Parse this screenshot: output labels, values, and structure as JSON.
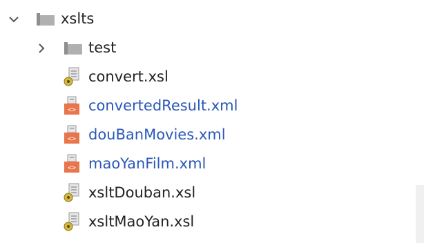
{
  "tree": {
    "root": {
      "label": "xslts",
      "expanded": true
    },
    "children": [
      {
        "label": "test",
        "kind": "folder",
        "expanded": false
      },
      {
        "label": "convert.xsl",
        "kind": "xsl"
      },
      {
        "label": "convertedResult.xml",
        "kind": "xml"
      },
      {
        "label": "douBanMovies.xml",
        "kind": "xml"
      },
      {
        "label": "maoYanFilm.xml",
        "kind": "xml"
      },
      {
        "label": "xsltDouban.xsl",
        "kind": "xsl"
      },
      {
        "label": "xsltMaoYan.xsl",
        "kind": "xsl"
      }
    ]
  },
  "colors": {
    "folder": "#a9a9a9",
    "xml_icon": "#e8764a",
    "xsl_badge": "#d4b83a",
    "blue_text": "#2a57b8"
  }
}
